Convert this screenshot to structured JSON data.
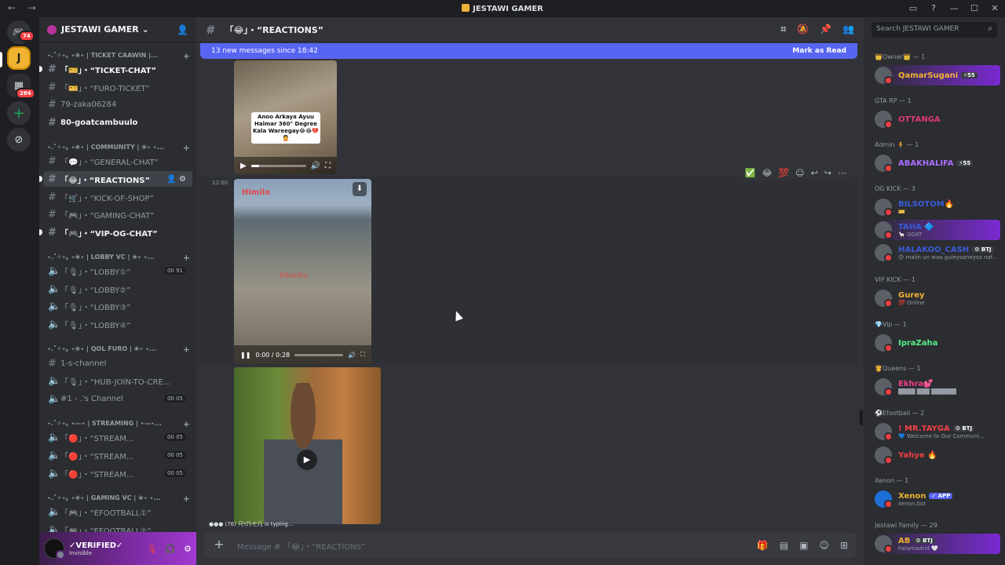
{
  "window": {
    "title": "JESTAWI GAMER"
  },
  "servers": {
    "home_badge": "74",
    "group_badge": "284"
  },
  "guild": {
    "name": "JESTAWI GAMER"
  },
  "categories": [
    {
      "label": "⋆.˚✧⋆｡ ⋆❀⋆ | TICKET CAAWIN |..."
    },
    {
      "label": "⋆.˚✧⋆｡ ⋆❀⋆ | COMMUNITY | ❀⋆ ⋆..."
    },
    {
      "label": "⋆.˚✧⋆｡ ⋆❀⋆ | LOBBY VC | ❀⋆ ⋆..."
    },
    {
      "label": "⋆.˚✧⋆｡ ⋆❀⋆ | QOL FURO | ❀⋆ ⋆..."
    },
    {
      "label": "⋆.˚✧⋆｡ ⋆—⋆ | STREAMING | ⋆—⋆..."
    },
    {
      "label": "⋆.˚✧⋆｡ ⋆❀⋆ | GAMING VC | ❀⋆ ⋆..."
    }
  ],
  "channels": [
    {
      "label": "「🎫」・“TICKET-CHAT”"
    },
    {
      "label": "「🎫」・“FURO-TICKET”"
    },
    {
      "label": "79-zaka06284"
    },
    {
      "label": "80-goatcambuulo"
    },
    {
      "label": "「💬」・“GENERAL-CHAT”"
    },
    {
      "label": "「😂」・“REACTIONS”"
    },
    {
      "label": "「🛒」・“KICK-OF-SHOP”"
    },
    {
      "label": "「🎮」・“GAMING-CHAT”"
    },
    {
      "label": "「🎮」・“VIP-OG-CHAT”"
    },
    {
      "label": "「🎙」・“LOBBY①”",
      "count": "00 91"
    },
    {
      "label": "「🎙」・“LOBBY②”"
    },
    {
      "label": "「🎙」・“LOBBY③”"
    },
    {
      "label": "「🎙」・“LOBBY④”"
    },
    {
      "label": "1-s-channel"
    },
    {
      "label": "「🎙」・“HUB-JOIN-TO-CRE..."
    },
    {
      "label": "#1 - .'s Channel",
      "count": "00 05"
    },
    {
      "label": "「🔴」・“STREAM...",
      "count": "00 05"
    },
    {
      "label": "「🔴」・“STREAM...",
      "count": "00 05"
    },
    {
      "label": "「🔴」・“STREAM...",
      "count": "00 05"
    },
    {
      "label": "「🎮」・“EFOOTBALL①”"
    },
    {
      "label": "「🎮」・“EFOOTBALL②”"
    }
  ],
  "user": {
    "name": "✓VERIFIED✓",
    "status": "Invisible"
  },
  "chat": {
    "channel_title": "「😂」・“REACTIONS”",
    "new_messages": "13 new messages since 18:42",
    "mark_read": "Mark as Read",
    "video1_caption": "Anoo Arkaya Ayuu Halmar 360° Degree Kala Wareegay😂😂💔🤦",
    "timestamp": "12:00",
    "watermark": "Himilo",
    "video2_time": "0:00 / 0:28",
    "typing": "(76) 尺ﾘ乃モ几 is typing...",
    "placeholder": "Message # 「😂」・“REACTIONS”"
  },
  "members": {
    "search_placeholder": "Search JESTAWI GAMER",
    "groups": [
      {
        "label": "👑Owner👑 — 1"
      },
      {
        "label": "GTA RP — 1"
      },
      {
        "label": "Admin 🧍 — 1"
      },
      {
        "label": "OG KICK — 3"
      },
      {
        "label": "VIP KICK — 1"
      },
      {
        "label": "💎Vip — 1"
      },
      {
        "label": "👸Queens — 1"
      },
      {
        "label": "⚽Efootball — 2"
      },
      {
        "label": "Xenon — 1"
      },
      {
        "label": "Jestawi Family — 29"
      }
    ],
    "list": [
      {
        "name": "QamarSugani",
        "tag": "⚡55",
        "color": "#f0b232"
      },
      {
        "name": "OTTANGA",
        "color": "#e0367a"
      },
      {
        "name": "ABAKHALIFA",
        "tag": "⚡55",
        "color": "#a970ff"
      },
      {
        "name": "BILSOTOM🔥",
        "sub": "🎫",
        "color": "#3a5bd9"
      },
      {
        "name": "TAHA 🔷",
        "sub": "🦙 GOAT",
        "color": "#3a5bd9"
      },
      {
        "name": "HALAKOO_CASH",
        "tag": "⚙ BTJ",
        "sub": "😊 malin un waa guleysaneysa naf...",
        "color": "#3a5bd9"
      },
      {
        "name": "Gurey",
        "sub": "💯 Online",
        "color": "#f0b232"
      },
      {
        "name": "IpraZaha",
        "color": "#57f287"
      },
      {
        "name": "Ekhra💕",
        "sub": "████ ███ ██████",
        "color": "#f23f8c"
      },
      {
        "name": "! MR.TAYGA",
        "tag": "⚙ BTJ",
        "sub": "💙 Welcome to Our Communi...",
        "color": "#f23f43"
      },
      {
        "name": "Yahye 🔥",
        "color": "#f23f43"
      },
      {
        "name": "Xenon",
        "tag": "✓ APP",
        "sub": "xenon.bot",
        "color": "#f0b232"
      },
      {
        "name": "AB",
        "tag": "⚙ BTJ",
        "sub": "halamadrid 🤍",
        "color": "#f0b232"
      }
    ]
  }
}
